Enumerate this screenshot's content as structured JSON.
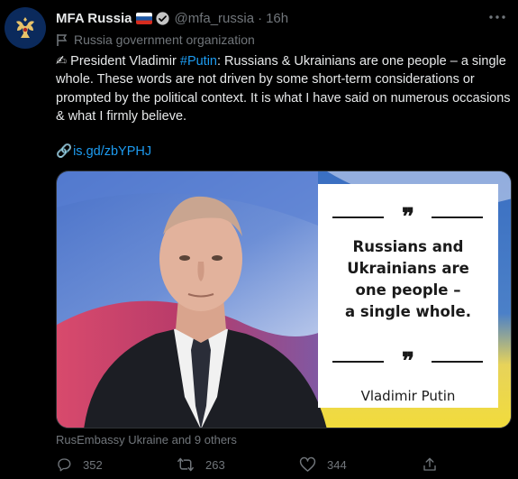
{
  "author": {
    "name": "MFA Russia",
    "handle": "@mfa_russia",
    "separator": "·",
    "time": "16h",
    "org_label": "Russia government organization"
  },
  "tweet": {
    "emoji": "✍",
    "text_before_hashtag": " President Vladimir ",
    "hashtag": "#Putin",
    "text_after_hashtag": ": Russians & Ukrainians are one people – a single whole. These words are not driven by some short-term considerations or prompted by the political context. It is what I have said on numerous occasions & what I firmly believe.",
    "link_emoji": "🔗",
    "link": "is.gd/zbYPHJ"
  },
  "media": {
    "quote_open": "❞",
    "quote_lines": [
      "Russians and",
      "Ukrainians are",
      "one people –",
      "a single whole."
    ],
    "quote_close": "❞",
    "author": "Vladimir Putin"
  },
  "tagged": "RusEmbassy Ukraine and 9 others",
  "actions": {
    "replies": "352",
    "retweets": "263",
    "likes": "344"
  },
  "colors": {
    "background": "#000000",
    "accent": "#1d9bf0",
    "muted": "#71767b",
    "text": "#e7e9ea"
  }
}
